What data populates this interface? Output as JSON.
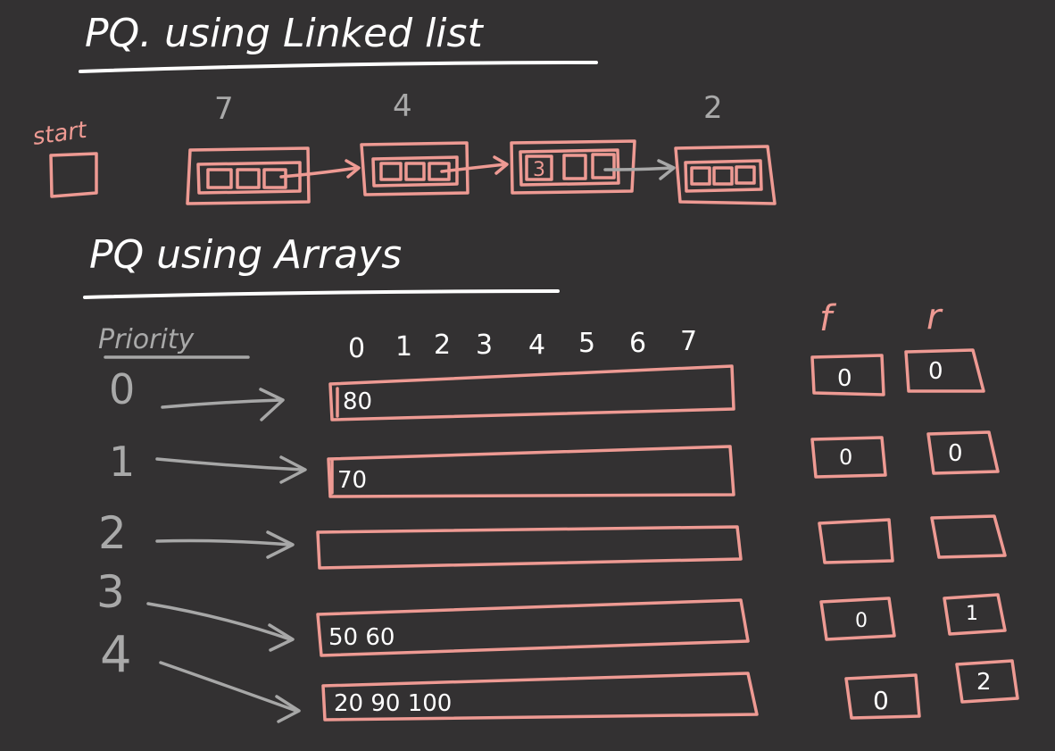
{
  "linked_list": {
    "title": "PQ. using Linked list",
    "start_label": "start",
    "node_priorities": [
      "7",
      "4",
      "",
      "2"
    ],
    "node_values": [
      "",
      "",
      "3",
      ""
    ]
  },
  "arrays": {
    "title": "PQ using Arrays",
    "priority_header": "Priority",
    "index_labels": [
      "0",
      "1",
      "2",
      "3",
      "4",
      "5",
      "6",
      "7"
    ],
    "front_header": "f",
    "rear_header": "r",
    "rows": [
      {
        "priority": "0",
        "contents": "80",
        "front": "0",
        "rear": "0"
      },
      {
        "priority": "1",
        "contents": "70",
        "front": "0",
        "rear": "0"
      },
      {
        "priority": "2",
        "contents": "",
        "front": "",
        "rear": ""
      },
      {
        "priority": "3",
        "contents": "",
        "front": "",
        "rear": ""
      },
      {
        "priority": "4",
        "contents": "50 60",
        "front": "0",
        "rear": "1"
      },
      {
        "priority": "",
        "contents": "20 90 100",
        "front": "0",
        "rear": "2"
      }
    ]
  }
}
